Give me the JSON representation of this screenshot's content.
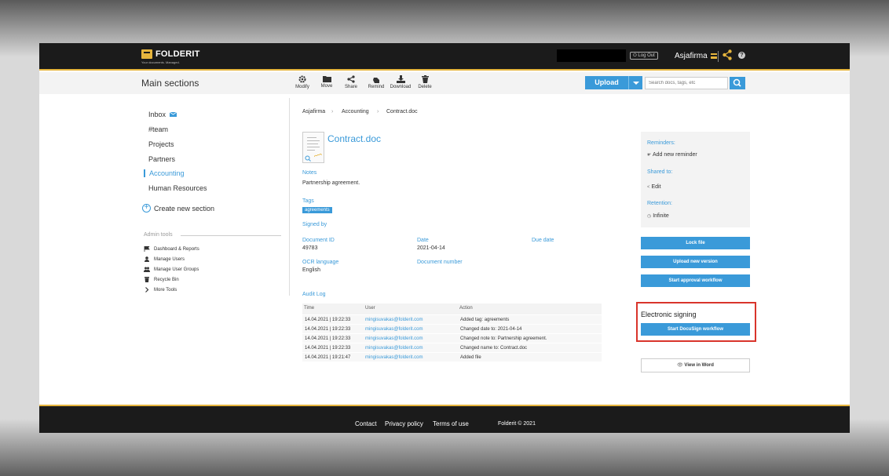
{
  "brand": {
    "name": "FOLDERIT",
    "tagline": "Your documents. Managed."
  },
  "topbar": {
    "logout_label": "Log Out",
    "company": "Asjafirma"
  },
  "subbar": {
    "title": "Main sections",
    "tools": [
      {
        "label": "Modify",
        "icon": "gear-icon"
      },
      {
        "label": "Move",
        "icon": "folder-icon"
      },
      {
        "label": "Share",
        "icon": "share-icon"
      },
      {
        "label": "Remind",
        "icon": "hand-icon"
      },
      {
        "label": "Download",
        "icon": "download-icon"
      },
      {
        "label": "Delete",
        "icon": "trash-icon"
      }
    ],
    "upload_label": "Upload",
    "search_placeholder": "Search docs, tags, etc"
  },
  "sidebar": {
    "items": [
      {
        "label": "Inbox"
      },
      {
        "label": "#team"
      },
      {
        "label": "Projects"
      },
      {
        "label": "Partners"
      },
      {
        "label": "Accounting",
        "active": true
      },
      {
        "label": "Human Resources"
      }
    ],
    "create_label": "Create new section",
    "admin_title": "Admin tools",
    "admin_items": [
      {
        "label": "Dashboard & Reports",
        "icon": "flag-icon"
      },
      {
        "label": "Manage Users",
        "icon": "user-icon"
      },
      {
        "label": "Manage User Groups",
        "icon": "users-icon"
      },
      {
        "label": "Recycle Bin",
        "icon": "trash-icon"
      },
      {
        "label": "More Tools",
        "icon": "chevron-right-icon"
      }
    ]
  },
  "breadcrumb": [
    "Asjafirma",
    "Accounting",
    "Contract.doc"
  ],
  "document": {
    "filename": "Contract.doc",
    "notes_label": "Notes",
    "notes": "Partnership agreement.",
    "tags_label": "Tags",
    "tag": "agreements",
    "signed_by_label": "Signed by",
    "doc_id_label": "Document ID",
    "doc_id": "49783",
    "date_label": "Date",
    "date": "2021-04-14",
    "due_date_label": "Due date",
    "ocr_label": "OCR language",
    "ocr": "English",
    "doc_number_label": "Document number"
  },
  "audit": {
    "title": "Audit Log",
    "headers": [
      "Time",
      "User",
      "Action"
    ],
    "rows": [
      {
        "time": "14.04.2021 | 19:22:33",
        "user": "mingisuvakas@folderit.com",
        "action": "Added tag: agreements"
      },
      {
        "time": "14.04.2021 | 19:22:33",
        "user": "mingisuvakas@folderit.com",
        "action": "Changed date to: 2021-04-14"
      },
      {
        "time": "14.04.2021 | 19:22:33",
        "user": "mingisuvakas@folderit.com",
        "action": "Changed note to: Partnership agreement."
      },
      {
        "time": "14.04.2021 | 19:22:33",
        "user": "mingisuvakas@folderit.com",
        "action": "Changed name to: Contract.doc"
      },
      {
        "time": "14.04.2021 | 19:21:47",
        "user": "mingisuvakas@folderit.com",
        "action": "Added file"
      }
    ]
  },
  "panel": {
    "reminders_label": "Reminders:",
    "add_reminder": "Add new reminder",
    "shared_label": "Shared to:",
    "edit": "Edit",
    "retention_label": "Retention:",
    "retention": "Infinite"
  },
  "actions": {
    "lock": "Lock file",
    "upload_version": "Upload new version",
    "approval": "Start approval workflow",
    "esign_title": "Electronic signing",
    "docusign": "Start DocuSign workflow",
    "view_word": "View in Word"
  },
  "footer": {
    "contact": "Contact",
    "privacy": "Privacy policy",
    "terms": "Terms of use",
    "copyright": "Folderit © 2021"
  },
  "colors": {
    "accent": "#3a9ad9",
    "brand_yellow": "#e6b53d",
    "highlight_red": "#d9342b",
    "dark": "#1b1b1b"
  }
}
